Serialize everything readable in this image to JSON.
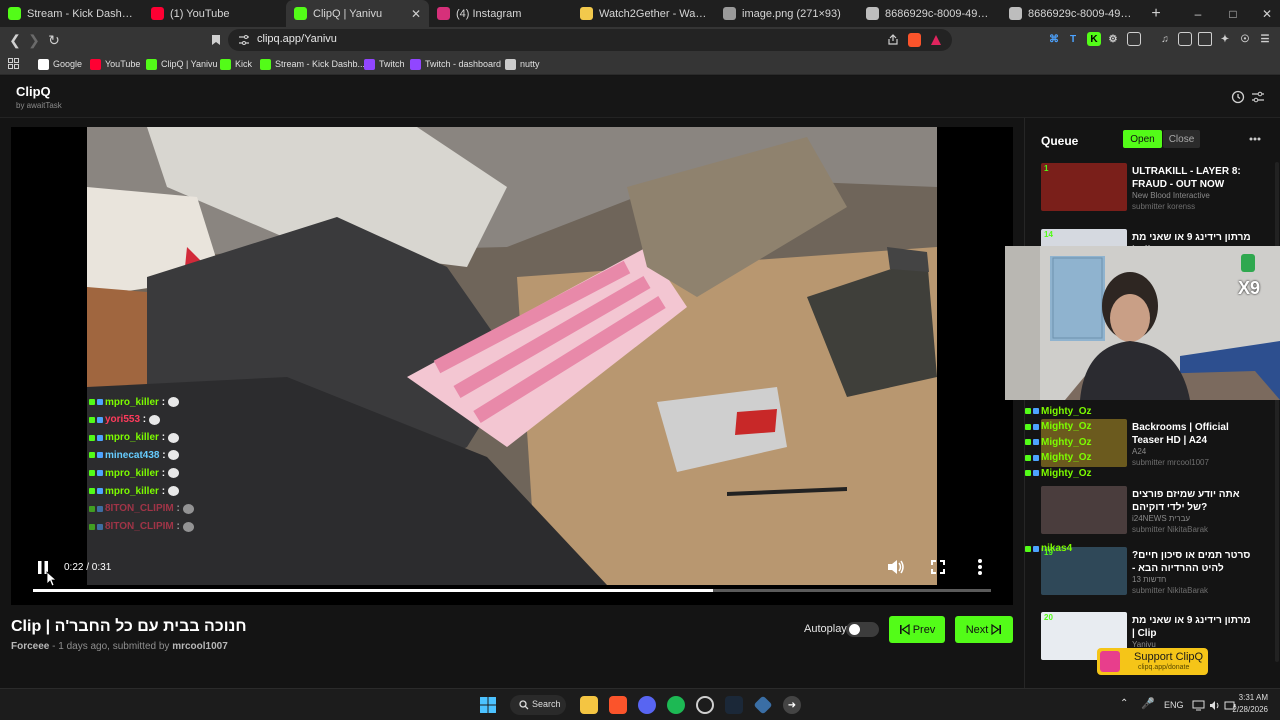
{
  "browser": {
    "tabs": [
      {
        "title": "Stream - Kick Dashboard",
        "active": false,
        "icon": "kick-icon",
        "color": "#53fc18"
      },
      {
        "title": "(1) YouTube",
        "active": false,
        "icon": "youtube-icon",
        "color": "#ff0033"
      },
      {
        "title": "ClipQ | Yanivu",
        "active": true,
        "icon": "clipq-icon",
        "color": "#53fc18"
      },
      {
        "title": "(4) Instagram",
        "active": false,
        "icon": "instagram-icon",
        "color": "#d6307a"
      },
      {
        "title": "Watch2Gether - Watch Videos",
        "active": false,
        "icon": "watch2gether-icon",
        "color": "#f2c94c"
      },
      {
        "title": "image.png (271×93)",
        "active": false,
        "icon": "image-icon",
        "color": "#9a9a9a"
      },
      {
        "title": "8686929c-8009-4952-bb72-53",
        "active": false,
        "icon": "globe-icon",
        "color": "#bdbdbd"
      },
      {
        "title": "8686929c-8009-4952-bb72-53",
        "active": false,
        "icon": "globe-icon",
        "color": "#bdbdbd"
      }
    ],
    "url": "clipq.app/Yanivu",
    "bookmarks": [
      {
        "label": "Google",
        "color": "#ffffff"
      },
      {
        "label": "YouTube",
        "color": "#ff0033"
      },
      {
        "label": "ClipQ | Yanivu",
        "color": "#53fc18"
      },
      {
        "label": "Kick",
        "color": "#53fc18"
      },
      {
        "label": "Stream - Kick Dashb...",
        "color": "#53fc18"
      },
      {
        "label": "Twitch",
        "color": "#9146ff"
      },
      {
        "label": "Twitch - dashboard",
        "color": "#9146ff"
      },
      {
        "label": "nutty",
        "color": "#cccccc"
      }
    ]
  },
  "app": {
    "name": "ClipQ",
    "byline": "by awaitTask"
  },
  "player": {
    "time": "0:22 / 0:31",
    "progress": 0.71,
    "buffered": 0.7,
    "chat": [
      {
        "user": "mpro_killer",
        "color": "#7cfc00"
      },
      {
        "user": "yori553",
        "color": "#ff3b5c"
      },
      {
        "user": "mpro_killer",
        "color": "#7cfc00"
      },
      {
        "user": "minecat438",
        "color": "#66ccff"
      },
      {
        "user": "mpro_killer",
        "color": "#7cfc00"
      },
      {
        "user": "mpro_killer",
        "color": "#7cfc00"
      },
      {
        "user": "8ITON_CLIPIM",
        "color": "#ff3b5c"
      },
      {
        "user": "8ITON_CLIPIM",
        "color": "#ff3b5c"
      }
    ]
  },
  "clip": {
    "title": "חנוכה בבית עם כל החבר'ה | Clip",
    "channel": "Forceee",
    "meta": " - 1 days ago, submitted by ",
    "submitter": "mrcool1007"
  },
  "controls": {
    "autoplay_label": "Autoplay",
    "autoplay_on": false,
    "prev_label": "Prev",
    "next_label": "Next"
  },
  "queue": {
    "title": "Queue",
    "open_label": "Open",
    "close_label": "Close",
    "items": [
      {
        "num": "1",
        "title": "ULTRAKILL - LAYER 8: FRAUD - OUT NOW",
        "channel": "New Blood Interactive",
        "submitter": "submitter korenss"
      },
      {
        "num": "14",
        "title": "מרתון רידינג 9 או שאני מת | Clip",
        "channel": "",
        "submitter": ""
      },
      {
        "num": "",
        "title": "Backrooms | Official Teaser HD | A24",
        "channel": "A24",
        "submitter": "submitter mrcool1007"
      },
      {
        "num": "",
        "title": "אתה יודע שמיזם פורצים של ילדי דוקיהם?",
        "channel": "i24NEWS עברית",
        "submitter": "submitter NikitaBarak"
      },
      {
        "num": "19",
        "title": "סרטר תמים או סיכון חיים? להיט ההרדיוה הבא - דיאטת",
        "channel": "חדשות 13",
        "submitter": "submitter NikitaBarak"
      },
      {
        "num": "20",
        "title": "מרתון רידינג 9 או שאני מת | Clip",
        "channel": "Yanivu",
        "submitter": ""
      }
    ],
    "chat_overlay": [
      "Mighty_Oz",
      "Mighty_Oz",
      "Mighty_Oz",
      "Mighty_Oz",
      "Mighty_Oz",
      "nikas4"
    ]
  },
  "support": {
    "label": "Support ClipQ",
    "sub": "clipq.app/donate"
  },
  "webcam": {
    "badge": "X9"
  },
  "taskbar": {
    "search_label": "Search",
    "lang": "ENG",
    "time": "3:31 AM",
    "date": "2/28/2026"
  },
  "colors": {
    "accent": "#53fc18",
    "support": "#f5c518"
  }
}
